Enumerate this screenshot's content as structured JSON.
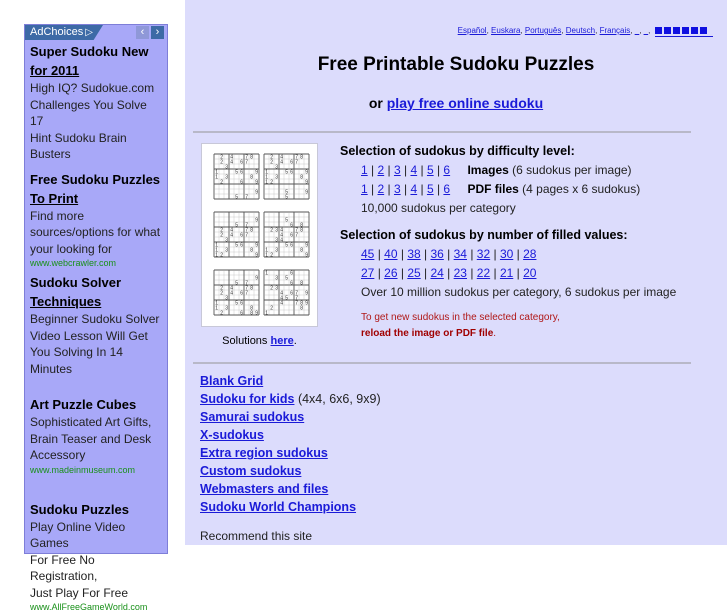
{
  "ad": {
    "adchoices_label": "AdChoices",
    "adchoices_icon": "play-triangle-icon",
    "prev_icon": "chevron-left-icon",
    "next_icon": "chevron-right-icon",
    "items": [
      {
        "title_line1": "Super Sudoku New",
        "title_line2": "for 2011",
        "text": [
          "High IQ? Sudokue.com",
          "Challenges You Solve 17",
          "Hint Sudoku Brain",
          "Busters"
        ],
        "url": ""
      },
      {
        "title_line1": "Free Sudoku Puzzles",
        "title_line2": "To Print",
        "text": [
          "Find more",
          "sources/options for what",
          "your looking for"
        ],
        "url": "www.webcrawler.com"
      },
      {
        "title_line1": "Sudoku Solver",
        "title_line2": "Techniques",
        "text": [
          "Beginner Sudoku Solver",
          "Video Lesson Will Get",
          "You Solving In 14",
          "Minutes"
        ],
        "url": ""
      },
      {
        "title_line1": "Art Puzzle Cubes",
        "title_line2": "",
        "text": [
          "Sophisticated Art Gifts,",
          "Brain Teaser and Desk",
          "Accessory"
        ],
        "url": "www.madeinmuseum.com"
      },
      {
        "title_line1": "Sudoku Puzzles",
        "title_line2": "",
        "text": [
          "Play Online Video Games",
          "For Free No Registration,",
          "Just Play For Free"
        ],
        "url": "www.AllFreeGameWorld.com"
      }
    ]
  },
  "languages": {
    "links": [
      "Español",
      "Euskara",
      "Português",
      "Deutsch",
      "Français",
      "_",
      "_"
    ],
    "flags_icon": "language-flags-icon"
  },
  "header": {
    "title": "Free Printable Sudoku Puzzles",
    "online_prefix": "or",
    "online_link": "play free online sudoku"
  },
  "preview": {
    "image_alt": "sudoku-sheet-thumbnail",
    "solutions_prefix": "Solutions",
    "solutions_link": "here",
    "solutions_suffix": "."
  },
  "difficulty": {
    "heading": "Selection of sudokus by difficulty level:",
    "levels": [
      "1",
      "2",
      "3",
      "4",
      "5",
      "6"
    ],
    "images_label": "Images",
    "images_note": "(6 sudokus per image)",
    "pdf_label": "PDF files",
    "pdf_note": "(4 pages x 6 sudokus)",
    "count_note": "10,000 sudokus per category"
  },
  "filled": {
    "heading": "Selection of sudokus by number of filled values:",
    "row1": [
      "45",
      "40",
      "38",
      "36",
      "34",
      "32",
      "30",
      "28"
    ],
    "row2": [
      "27",
      "26",
      "25",
      "24",
      "23",
      "22",
      "21",
      "20"
    ],
    "count_note": "Over 10 million sudokus per category, 6 sudokus per image"
  },
  "reload": {
    "line1": "To get new sudokus in the selected category,",
    "line2_bold": "reload the image or PDF file",
    "line2_suffix": "."
  },
  "links": [
    {
      "label": "Blank Grid",
      "note": ""
    },
    {
      "label": "Sudoku for kids",
      "note": "(4x4, 6x6, 9x9)"
    },
    {
      "label": "Samurai sudokus",
      "note": ""
    },
    {
      "label": "X-sudokus",
      "note": ""
    },
    {
      "label": "Extra region sudokus",
      "note": ""
    },
    {
      "label": "Custom sudokus",
      "note": ""
    },
    {
      "label": "Webmasters and files",
      "note": ""
    },
    {
      "label": "Sudoku World Champions",
      "note": ""
    }
  ],
  "footer": {
    "recommend": "Recommend this site"
  }
}
